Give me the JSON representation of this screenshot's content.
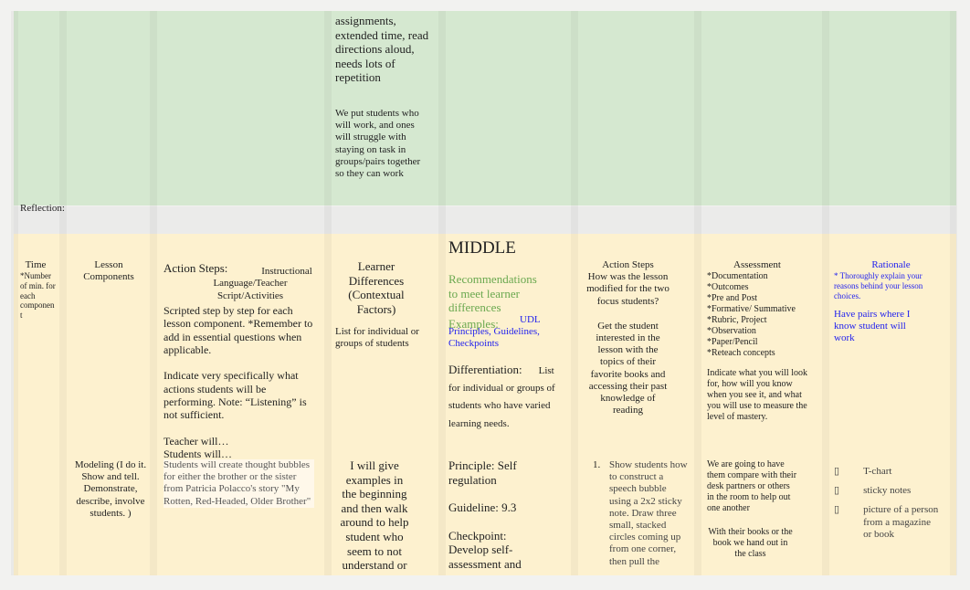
{
  "top_section": {
    "learner_differences_text": "assignments, extended time, read directions aloud, needs lots of repetition",
    "grouping_note": "We put students who will work, and ones will struggle with staying on task in groups/pairs together so they can work",
    "reflection_label": "Reflection:"
  },
  "middle_section": {
    "title": "MIDDLE",
    "headers": {
      "time": "Time",
      "time_note": "*Number of min. for each componen t",
      "lesson_components": "Lesson Components",
      "action_steps_title": "Action Steps:",
      "action_steps_subtitle": "Instructional Language/Teacher Script/Activities",
      "action_steps_p1": "Scripted step by step for each lesson component. *Remember to add in essential questions when applicable.",
      "action_steps_p2": "Indicate very specifically what actions students will be performing. Note: “Listening” is not sufficient.",
      "action_steps_p3a": "Teacher will…",
      "action_steps_p3b": "Students will…",
      "learner_differences": "Learner Differences (Contextual Factors)",
      "learner_differences_note": "List for individual or groups of students",
      "recommendations": "Recommendations to meet learner differences",
      "examples_label": "Examples:",
      "examples_link": "UDL Principles, Guidelines, Checkpoints",
      "differentiation_label": "Differentiation:",
      "differentiation_note": "List for individual or groups of students who have varied learning needs.",
      "action_steps2_title": "Action Steps",
      "action_steps2_question": "How was the lesson modified for the two focus students?",
      "action_steps2_answer": "Get the student interested in the lesson with the topics of their favorite books and accessing their past knowledge of reading",
      "assessment_title": "Assessment",
      "assessment_items": [
        "*Documentation",
        "*Outcomes",
        "*Pre and Post",
        "*Formative/ Summative",
        "*Rubric, Project",
        "*Observation",
        "*Paper/Pencil",
        "*Reteach concepts"
      ],
      "assessment_note": "Indicate what you will look for, how will you know when you see it, and what you will use to measure the level of mastery.",
      "rationale_title": "Rationale",
      "rationale_note": "* Thoroughly explain your reasons behind your lesson choices.",
      "rationale_answer": "Have pairs where I know student will work"
    },
    "row": {
      "lesson_component": "Modeling (I do it. Show and tell. Demonstrate, describe, involve students. )",
      "action_steps": "Students will create thought bubbles for either the brother or the sister from Patricia Polacco's story \"My Rotten, Red-Headed, Older Brother\"",
      "learner_differences": "I will give examples in the beginning and then walk around to help student who seem to not understand or",
      "principle": "Principle: Self regulation",
      "guideline": "Guideline: 9.3",
      "checkpoint": "Checkpoint: Develop self-assessment and",
      "step_number": "1.",
      "step_text": "Show students how to construct a speech bubble using a 2x2 sticky note. Draw three small, stacked circles coming up from one corner, then pull the",
      "assessment": "We are going to have them compare with their desk partners or others in the room to help out one another",
      "assessment_2": "With their books or the book we hand out in the class",
      "rationale_items": [
        "T-chart",
        "sticky notes",
        "picture of a person from a magazine or book"
      ],
      "bullet_glyph": "▯"
    }
  }
}
